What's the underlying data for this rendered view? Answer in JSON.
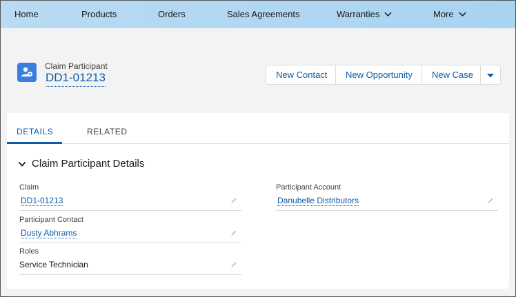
{
  "nav": {
    "items": [
      "Home",
      "Products",
      "Orders",
      "Sales Agreements"
    ],
    "dropdowns": [
      "Warranties",
      "More"
    ]
  },
  "record": {
    "object_type": "Claim Participant",
    "name": "DD1-01213",
    "icon": "contact-icon",
    "icon_color": "#3c7ee0"
  },
  "actions": {
    "new_contact": "New Contact",
    "new_opportunity": "New Opportunity",
    "new_case": "New Case"
  },
  "tabs": [
    "DETAILS",
    "RELATED"
  ],
  "section": {
    "title": "Claim Participant Details",
    "fields": {
      "claim": {
        "label": "Claim",
        "value": "DD1-01213"
      },
      "participant_account": {
        "label": "Participant Account",
        "value": "Danubelle Distributors"
      },
      "participant_contact": {
        "label": "Participant Contact",
        "value": "Dusty Abhrams"
      },
      "roles": {
        "label": "Roles",
        "value": "Service Technician"
      }
    }
  },
  "colors": {
    "accent": "#0b5cab",
    "nav_bg": "#b9dbf3"
  }
}
